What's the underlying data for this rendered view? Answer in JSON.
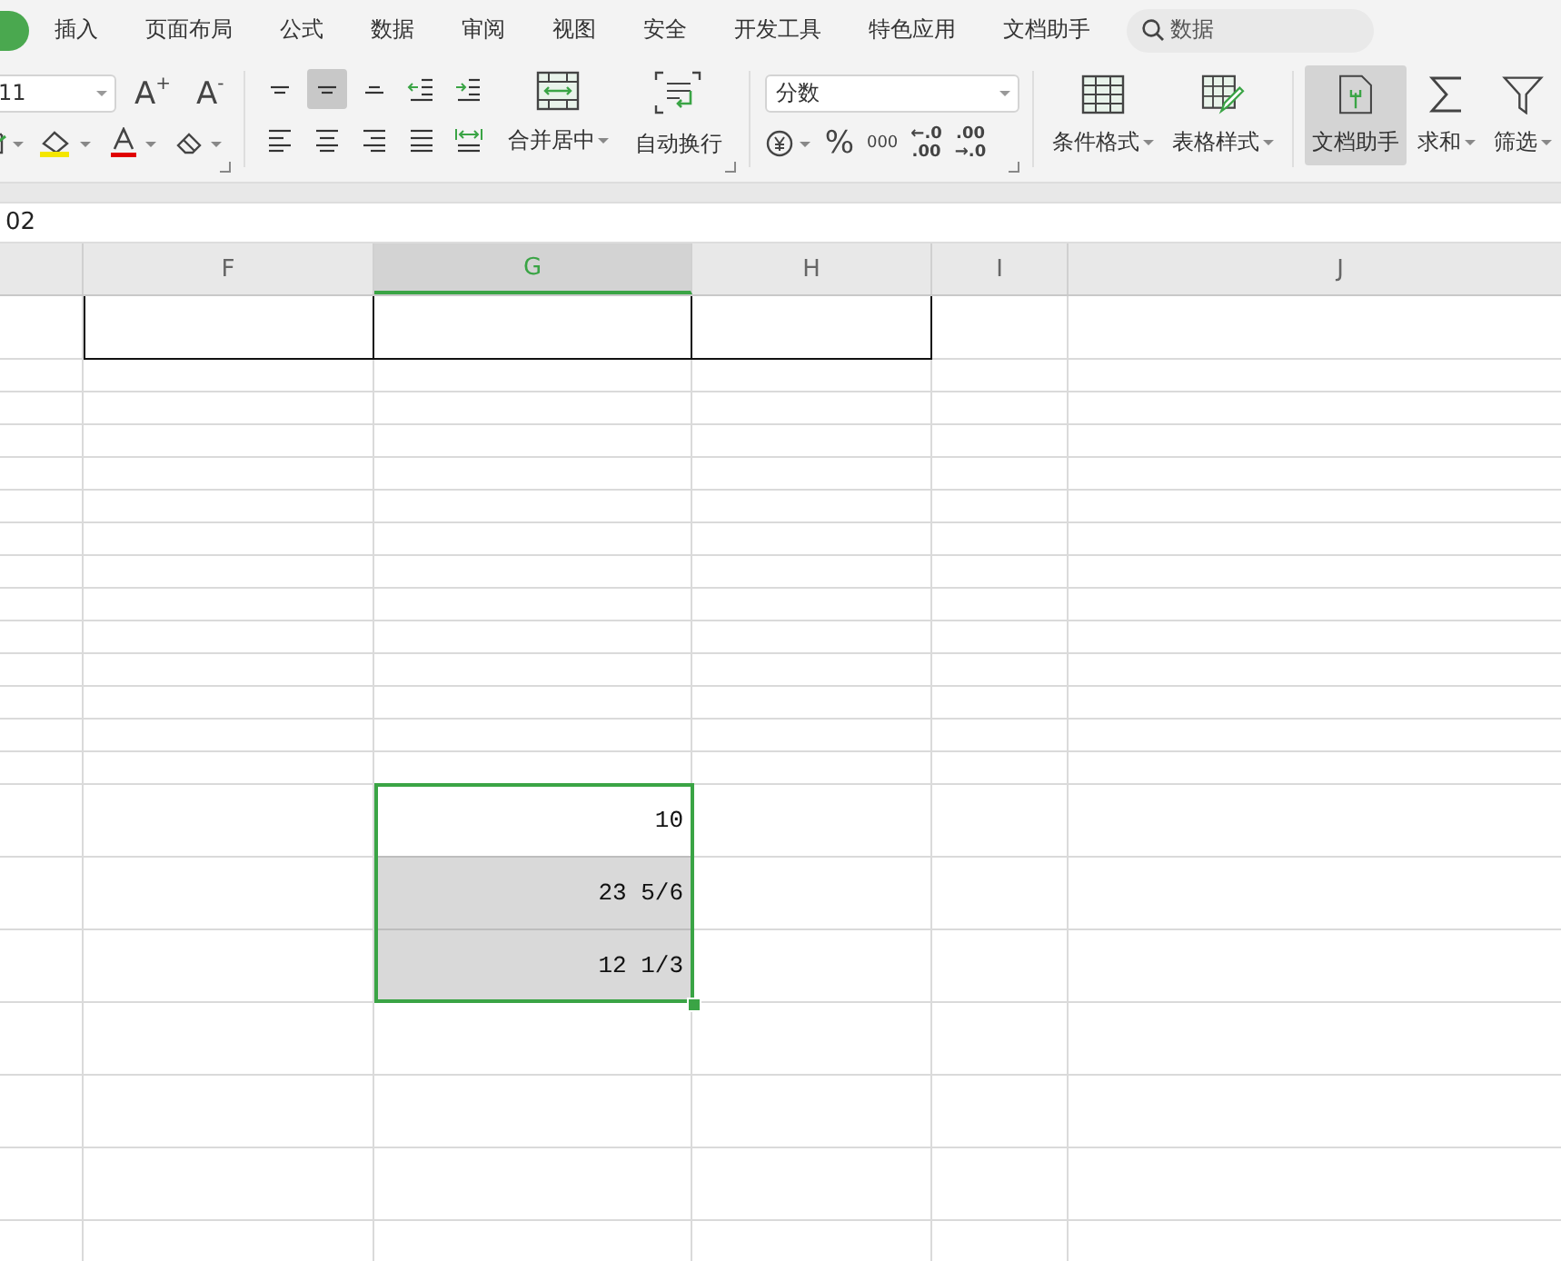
{
  "menu": {
    "tabs": [
      {
        "selected": true
      },
      {
        "label": "插入",
        "selected": false
      },
      {
        "label": "页面布局",
        "selected": false
      },
      {
        "label": "公式",
        "selected": false
      },
      {
        "label": "数据",
        "selected": false
      },
      {
        "label": "审阅",
        "selected": false
      },
      {
        "label": "视图",
        "selected": false
      },
      {
        "label": "安全",
        "selected": false
      },
      {
        "label": "开发工具",
        "selected": false
      },
      {
        "label": "特色应用",
        "selected": false
      },
      {
        "label": "文档助手",
        "selected": false
      }
    ],
    "search": {
      "value": "数据"
    }
  },
  "ribbon": {
    "font_size": "11",
    "grow_font": "A$^{+}$",
    "shrink_font": "A$^{-}$",
    "align_buttons": [
      {
        "kind": "top",
        "selected": false
      },
      {
        "kind": "middle",
        "selected": true
      },
      {
        "kind": "bottom",
        "selected": false
      },
      {
        "kind": "outdent",
        "selected": false
      },
      {
        "kind": "indent",
        "selected": false
      },
      {
        "kind": "left",
        "selected": false
      },
      {
        "kind": "center",
        "selected": false
      },
      {
        "kind": "right",
        "selected": false
      },
      {
        "kind": "justify",
        "selected": false
      },
      {
        "kind": "distribute",
        "selected": false
      }
    ],
    "merge": "合并居中",
    "wrap": "自动换行",
    "number_format": "分数",
    "percent": "%",
    "thousands": "000",
    "inc_decimal": [
      "←.0",
      ".00"
    ],
    "dec_decimal": [
      ".00",
      "→.0"
    ],
    "big_buttons": [
      {
        "kind": "conditional",
        "label": "条件格式",
        "dropdown": true,
        "selected": false
      },
      {
        "kind": "table",
        "label": "表格样式",
        "dropdown": true,
        "selected": false
      },
      {
        "kind": "assistant",
        "label": "文档助手",
        "dropdown": false,
        "selected": true
      },
      {
        "kind": "sum",
        "label": "求和",
        "dropdown": true,
        "selected": false
      },
      {
        "kind": "filter",
        "label": "筛选",
        "dropdown": true,
        "selected": false
      }
    ]
  },
  "formula_bar": {
    "value": "02"
  },
  "sheet": {
    "columns": [
      {
        "label": "F",
        "selected": false
      },
      {
        "label": "G",
        "selected": true
      },
      {
        "label": "H",
        "selected": false
      },
      {
        "label": "I",
        "selected": false
      },
      {
        "label": "J",
        "selected": false
      }
    ],
    "cells": [
      {
        "value": "10",
        "active": true
      },
      {
        "value": "23 5/6",
        "active": false
      },
      {
        "value": "12 1/3",
        "active": false
      }
    ]
  }
}
